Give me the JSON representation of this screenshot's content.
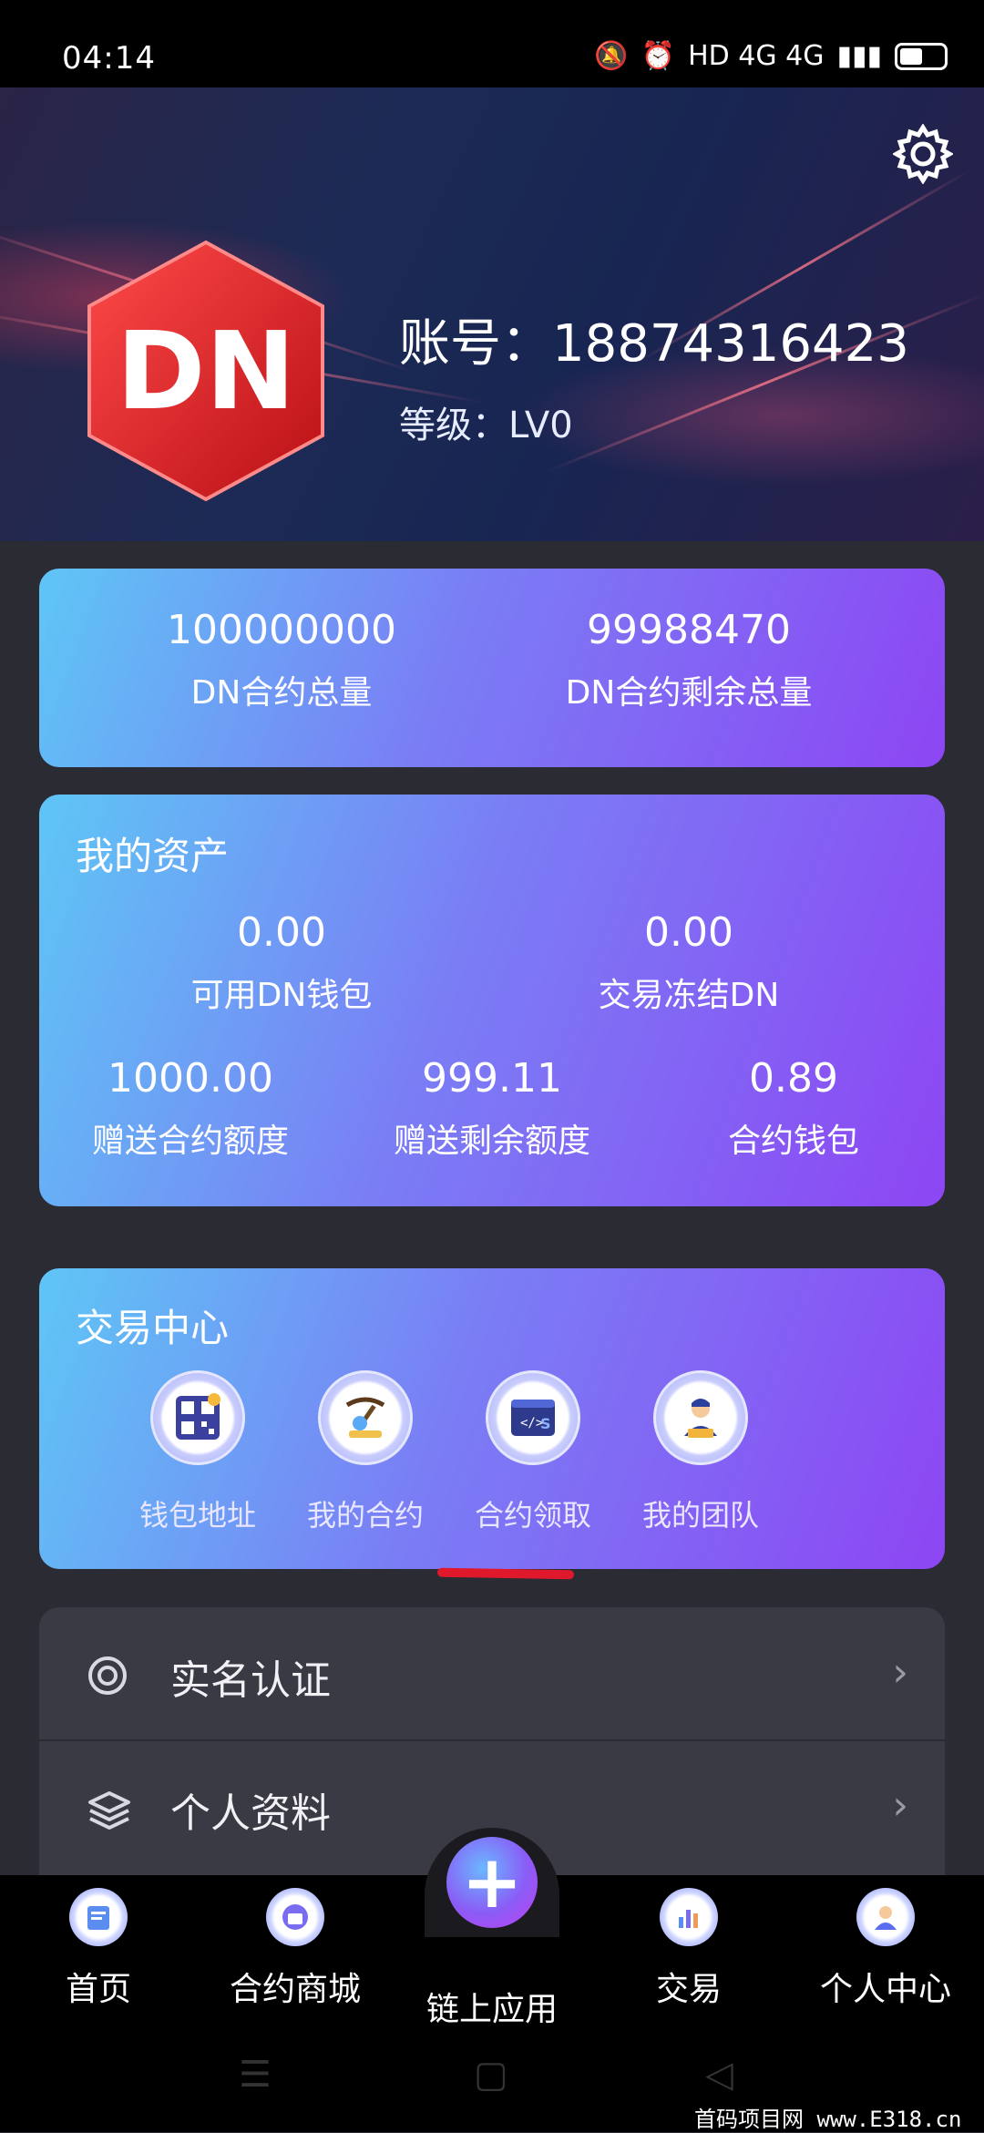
{
  "status_bar": {
    "time": "04:14",
    "network": "HD 4G 4G"
  },
  "profile": {
    "account_label": "账号：",
    "account_value": "18874316423",
    "level_label": "等级：",
    "level_value": "LV0",
    "logo_text": "DN"
  },
  "totals": [
    {
      "value": "100000000",
      "label": "DN合约总量"
    },
    {
      "value": "99988470",
      "label": "DN合约剩余总量"
    }
  ],
  "assets": {
    "title": "我的资产",
    "top": [
      {
        "value": "0.00",
        "label": "可用DN钱包"
      },
      {
        "value": "0.00",
        "label": "交易冻结DN"
      }
    ],
    "bottom": [
      {
        "value": "1000.00",
        "label": "赠送合约额度"
      },
      {
        "value": "999.11",
        "label": "赠送剩余额度"
      },
      {
        "value": "0.89",
        "label": "合约钱包"
      }
    ]
  },
  "trade_center": {
    "title": "交易中心",
    "items": [
      {
        "label": "钱包地址",
        "icon": "qr-wallet-icon"
      },
      {
        "label": "我的合约",
        "icon": "mining-icon"
      },
      {
        "label": "合约领取",
        "icon": "code-window-icon"
      },
      {
        "label": "我的团队",
        "icon": "team-icon"
      }
    ]
  },
  "menu": [
    {
      "label": "实名认证",
      "icon": "target-icon"
    },
    {
      "label": "个人资料",
      "icon": "layers-icon"
    }
  ],
  "bottom_nav": [
    {
      "label": "首页",
      "icon": "home-icon"
    },
    {
      "label": "合约商城",
      "icon": "mall-icon"
    },
    {
      "label": "链上应用",
      "icon": "plus-icon"
    },
    {
      "label": "交易",
      "icon": "chart-icon"
    },
    {
      "label": "个人中心",
      "icon": "user-icon"
    }
  ],
  "watermark": "首码项目网 www.E318.cn"
}
